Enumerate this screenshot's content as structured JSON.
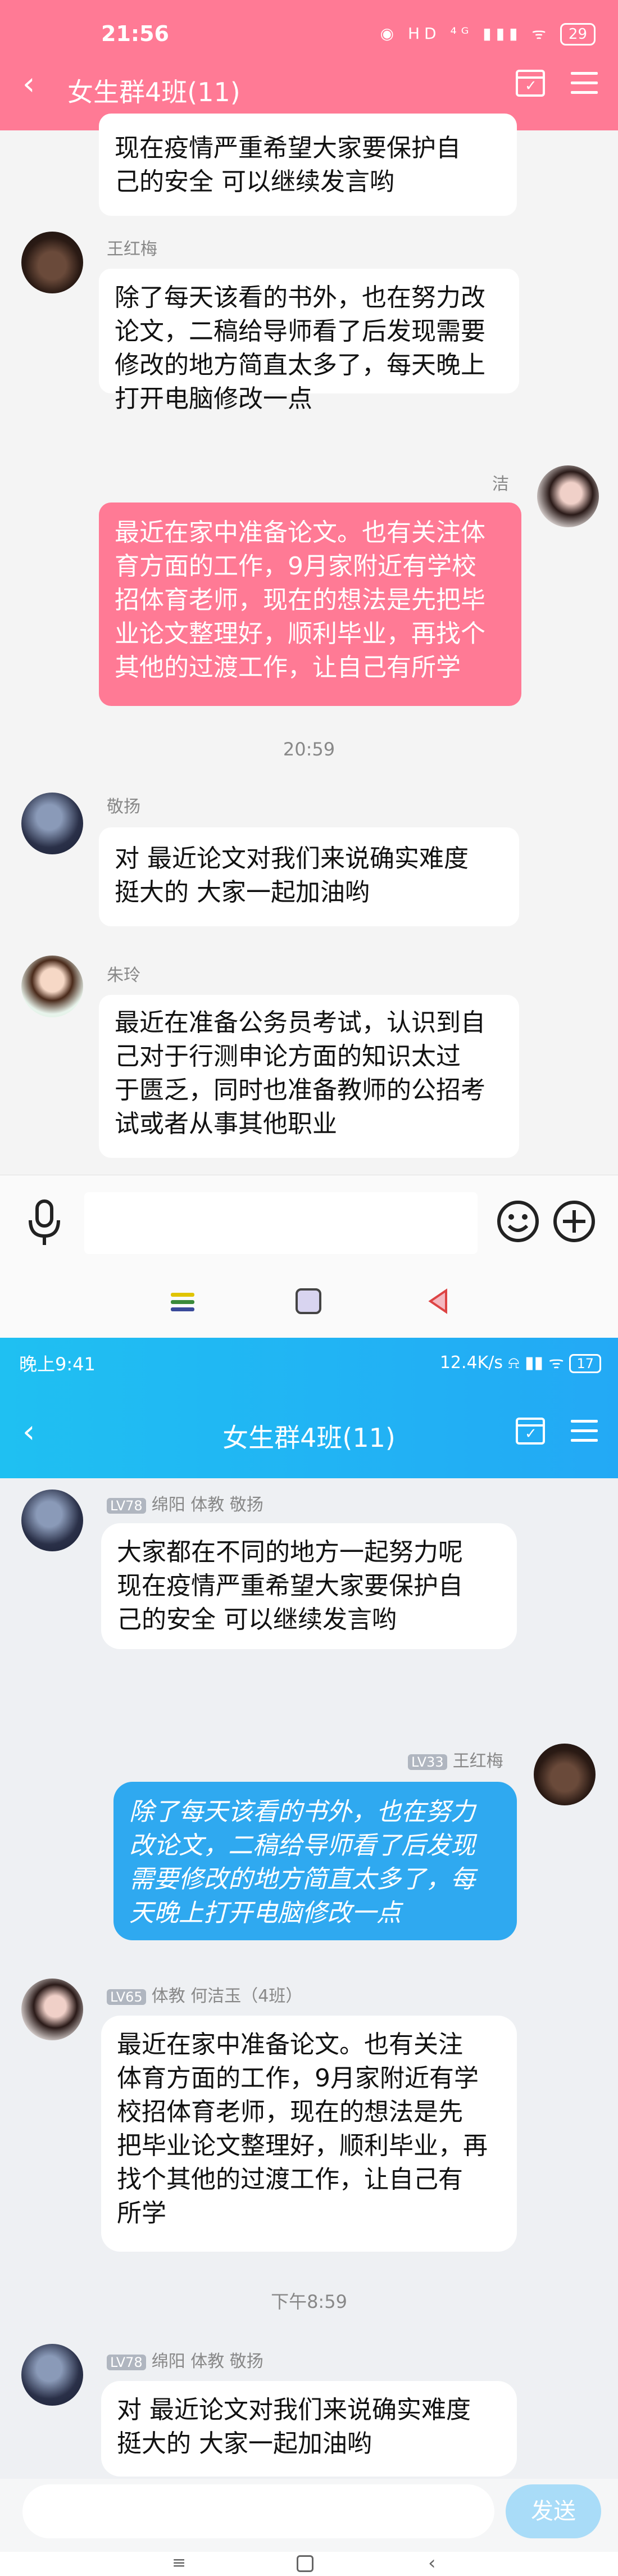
{
  "screen1": {
    "status_time": "21:56",
    "status_icons": "◉ HD ⁴ᴳ ▮▮▮ ᯤ",
    "battery": "29",
    "back": "‹",
    "title": "女生群4班(11)",
    "messages": [
      {
        "text": "现在疫情严重希望大家要保护自\n己的安全 可以继续发言哟"
      },
      {
        "name": "王红梅",
        "text": "除了每天该看的书外，也在努力改\n论文，二稿给导师看了后发现需要\n修改的地方简直太多了，每天晚上\n打开电脑修改一点"
      },
      {
        "name": "洁",
        "text": "最近在家中准备论文。也有关注体\n育方面的工作，9月家附近有学校\n招体育老师，现在的想法是先把毕\n业论文整理好，顺利毕业，再找个\n其他的过渡工作，让自己有所学"
      },
      {
        "name": "敬扬",
        "text": "对 最近论文对我们来说确实难度\n挺大的 大家一起加油哟"
      },
      {
        "name": "朱玲",
        "text": "最近在准备公务员考试，认识到自\n己对于行测申论方面的知识太过\n于匮乏，同时也准备教师的公招考\n试或者从事其他职业"
      }
    ],
    "timestamp": "20:59",
    "colors": {
      "header": "#ff7a95",
      "bubble_self": "#ff7a95"
    }
  },
  "screen2": {
    "status_time": "晚上9:41",
    "status_right": "12.4K/s ⍾ ▮▮ ᯤ",
    "battery": "17",
    "back": "‹",
    "title": "女生群4班(11)",
    "messages": [
      {
        "level": "LV78",
        "meta": "绵阳 体教 敬扬",
        "text": "大家都在不同的地方一起努力呢\n现在疫情严重希望大家要保护自\n己的安全 可以继续发言哟"
      },
      {
        "level": "LV33",
        "meta": "王红梅",
        "text": "除了每天该看的书外，也在努力\n改论文，二稿给导师看了后发现\n需要修改的地方简直太多了，每\n天晚上打开电脑修改一点"
      },
      {
        "level": "LV65",
        "meta": "体教   何洁玉（4班）",
        "text": "最近在家中准备论文。也有关注\n体育方面的工作，9月家附近有学\n校招体育老师，现在的想法是先\n把毕业论文整理好，顺利毕业，再\n找个其他的过渡工作，让自己有\n所学"
      },
      {
        "level": "LV78",
        "meta": "绵阳 体教 敬扬",
        "text": "对 最近论文对我们来说确实难度\n挺大的 大家一起加油哟"
      }
    ],
    "timestamp": "下午8:59",
    "send": "发送",
    "colors": {
      "header": "#1fb7f3",
      "bubble_self": "#2fa9f0"
    }
  }
}
